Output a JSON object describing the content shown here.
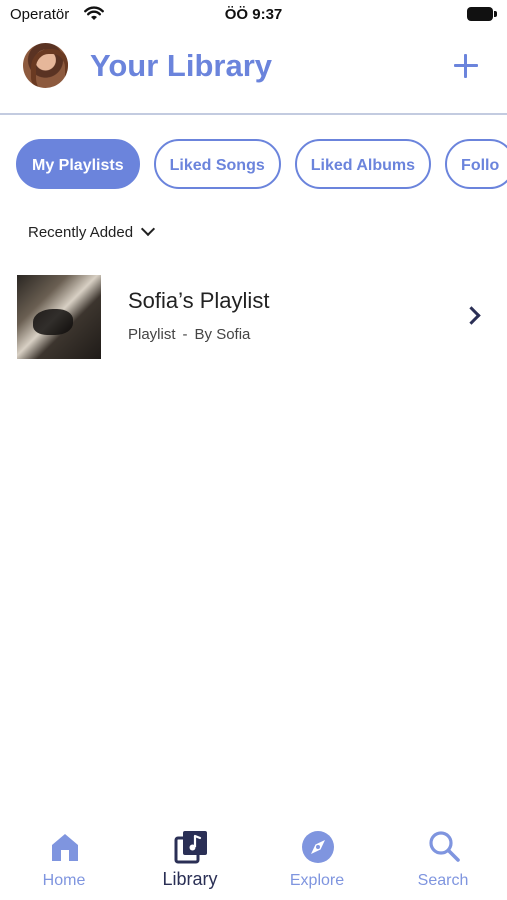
{
  "status_bar": {
    "carrier": "Operatör",
    "time": "ÖÖ 9:37"
  },
  "header": {
    "title": "Your Library"
  },
  "filters": [
    {
      "label": "My Playlists",
      "active": true
    },
    {
      "label": "Liked Songs",
      "active": false
    },
    {
      "label": "Liked Albums",
      "active": false
    },
    {
      "label": "Follo",
      "active": false
    }
  ],
  "sort": {
    "label": "Recently Added"
  },
  "playlists": [
    {
      "name": "Sofia’s Playlist",
      "type": "Playlist",
      "separator": "-",
      "owner": "By Sofia"
    }
  ],
  "tabs": [
    {
      "label": "Home",
      "icon": "home-icon",
      "active": false
    },
    {
      "label": "Library",
      "icon": "library-icon",
      "active": true
    },
    {
      "label": "Explore",
      "icon": "compass-icon",
      "active": false
    },
    {
      "label": "Search",
      "icon": "search-icon",
      "active": false
    }
  ],
  "colors": {
    "accent": "#6b84dc",
    "dark": "#2a2f55",
    "tab_inactive": "#7f95df"
  }
}
